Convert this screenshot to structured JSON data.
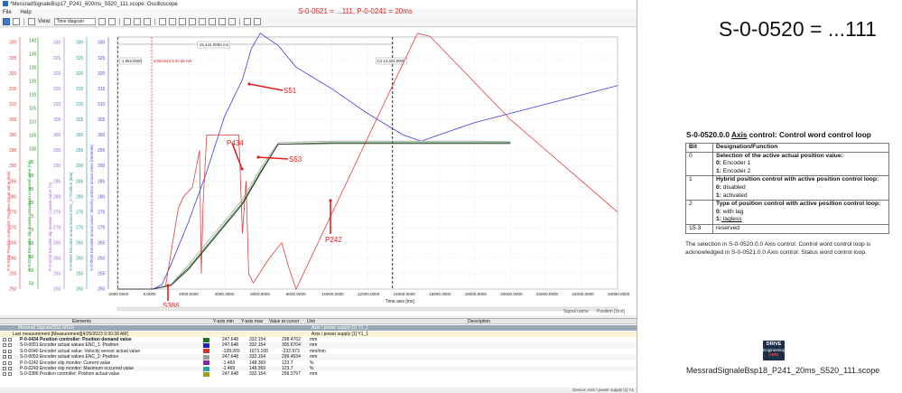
{
  "window": {
    "title": "*MessradSignaleBsp17_P241_600ms_S520_111.scope: Oscilloscope",
    "menu": [
      "File",
      "Help"
    ],
    "overlay_title": "S-0-0521 = ...111, P-0-0241 = 20ms"
  },
  "toolbar": {
    "view_label": "View:",
    "view_value": "Time diagram"
  },
  "chart_data": {
    "type": "line",
    "x_ticks": [
      "-2000.0000",
      "0.0000",
      "2000.0000",
      "4000.0000",
      "6000.0000",
      "8000.0000",
      "10000.0000",
      "12000.0000",
      "14000.0000",
      "16000.0000",
      "18000.0000",
      "20000.0000",
      "22000.0000",
      "24000.0000",
      "26000.0000"
    ],
    "xlabel": "Time axis [ms]",
    "xlim": [
      -2000,
      26000
    ],
    "y_ticks": [
      "330",
      "325",
      "320",
      "315",
      "310",
      "305",
      "300",
      "295",
      "290",
      "285",
      "280",
      "275",
      "270",
      "265",
      "260",
      "255",
      "250"
    ],
    "ylim": [
      247.648,
      332.154
    ],
    "axis_labels": [
      "S-0-0386 Position controller: Position actual value [mm]",
      "P-0-0243 Encoder slip monitor: Maximum occurred value [%]",
      "P-0-0242 Encoder slip monitor: Current value [%]",
      "S-0-0053 Encoder actual values ENC_2: Position [mm]",
      "S-0-0040 Encoder actual value: Velocity sensor actual value [mm/min]"
    ],
    "second_axis_ticks": [
      "140",
      "135",
      "130",
      "125",
      "120",
      "115",
      "110",
      "105",
      "100",
      "95",
      "90",
      "85",
      "80",
      "75",
      "70",
      "65",
      "60",
      "55",
      "50"
    ],
    "cursors": [
      {
        "label": "C1 -1.962.0000",
        "x": -1962
      },
      {
        "label": "C2 13.402.0000",
        "x": 13402
      }
    ],
    "cursor_delta": "15.444.0000 ms",
    "timestamp_label": "4/25/2023 9:30:38 AM",
    "annotations": [
      "S51",
      "P434",
      "S53",
      "P242",
      "S386"
    ],
    "series": [
      {
        "name": "P-0-0434 Position controller: Position demand value",
        "color": "#1a7a1a",
        "x": [
          -2000,
          0,
          1000,
          2000,
          3000,
          4000,
          5000,
          6000,
          7000,
          10000,
          14000,
          18000,
          20000
        ],
        "y": [
          250,
          250,
          251.5,
          257,
          264,
          271,
          278,
          288,
          297,
          297.5,
          297.5,
          297.5,
          297.5
        ]
      },
      {
        "name": "S-0-0051 Encoder actual values ENC_1: Position",
        "color": "#3c3cdc",
        "x": [
          -2000,
          0,
          500,
          1000,
          2000,
          3000,
          4000,
          5000,
          5500,
          6000,
          7000,
          8000,
          10000,
          12000,
          14000,
          15000,
          16000,
          18000,
          20000,
          22000,
          24000,
          26000
        ],
        "y": [
          250,
          250,
          251.5,
          258,
          272,
          288,
          306,
          318,
          328,
          333,
          329,
          322,
          315,
          307,
          300,
          298,
          300,
          304,
          307,
          310,
          313,
          316
        ]
      },
      {
        "name": "S-0-0040 Encoder actual value: Velocity sensor actual value",
        "color": "#e04040",
        "x": [
          -2000,
          0,
          700,
          1400,
          1700,
          2200,
          2600,
          2700,
          2800,
          3000,
          3300,
          3800,
          4800,
          5000,
          5200,
          5350,
          5600,
          6500,
          7200,
          7600,
          8000,
          13400,
          14800,
          15500,
          17000,
          20000,
          23000,
          26000
        ],
        "y": [
          250,
          250,
          251,
          276,
          280,
          283,
          295,
          255,
          278,
          300,
          300,
          300,
          300,
          268,
          285,
          255,
          252,
          260,
          265,
          257,
          250,
          316,
          333,
          332,
          323,
          305,
          290,
          275
        ]
      },
      {
        "name": "S-0-0053 Encoder actual values ENC_2: Position",
        "color": "#a0a0a0",
        "x": [
          -2000,
          0,
          1000,
          2000,
          3000,
          4000,
          5000,
          6000,
          7000,
          10000,
          14000,
          18000,
          20000
        ],
        "y": [
          250,
          250,
          251.5,
          258,
          265,
          272,
          279,
          289,
          297.5,
          298,
          298,
          298,
          297.8
        ]
      },
      {
        "name": "S-0-0386 Position controller: Position actual value",
        "color": "#222222",
        "x": [
          -2000,
          0,
          1000,
          2000,
          3000,
          4000,
          5000,
          6000,
          7000,
          10000,
          14000,
          18000,
          20000
        ],
        "y": [
          250,
          250,
          251.2,
          256.5,
          263.5,
          270.5,
          277.5,
          287.5,
          297,
          297.2,
          297.2,
          297.2,
          297.2
        ]
      }
    ]
  },
  "table": {
    "headers": [
      "Elements",
      "Y-axis min",
      "Y-axis max",
      "Value at cursor",
      "Unit",
      "Description"
    ],
    "group1": {
      "label": "Messrad Signale(S51 MSG)",
      "desc": "Axis / power supply [1] Y1_1"
    },
    "group2": {
      "label": "Last measurement [Measurement][4/25/2023 9:30:38 AM]",
      "desc": "Axis / power supply [1] Y1_1"
    },
    "rows": [
      {
        "name": "P-0-0434 Position controller: Position demand value",
        "color": "#1a7a1a",
        "min": "247.648",
        "max": "332.154",
        "cursor": "298.4762",
        "unit": "mm",
        "bold": true
      },
      {
        "name": "S-0-0051 Encoder actual values ENC_1: Position",
        "color": "#2020c0",
        "min": "247.648",
        "max": "332.154",
        "cursor": "305.6704",
        "unit": "mm",
        "bold": false
      },
      {
        "name": "S-0-0040 Encoder actual value: Velocity sensor actual value",
        "color": "#e03030",
        "min": "-128.265",
        "max": "1073.100",
        "cursor": "-232.973",
        "unit": "mm/min",
        "bold": false
      },
      {
        "name": "S-0-0053 Encoder actual values ENC_2: Position",
        "color": "#9a9a9a",
        "min": "247.648",
        "max": "332.154",
        "cursor": "299.4534",
        "unit": "mm",
        "bold": false
      },
      {
        "name": "P-0-0242 Encoder slip monitor: Current value",
        "color": "#8a1fb0",
        "min": "-1.469",
        "max": "148.369",
        "cursor": "123.7",
        "unit": "%",
        "bold": false
      },
      {
        "name": "P-0-0243 Encoder slip monitor: Maximum occurred value",
        "color": "#1fa8a8",
        "min": "-1.469",
        "max": "148.369",
        "cursor": "123.7",
        "unit": "%",
        "bold": false
      },
      {
        "name": "S-0-0386 Position controller: Position actual value",
        "color": "#a0a000",
        "min": "247.648",
        "max": "332.154",
        "cursor": "299.3797",
        "unit": "mm",
        "bold": false
      }
    ],
    "signal_name_label": "Signal name",
    "position_label": "Position [Unit]",
    "status_text": "Device: Axis / power supply [1] Y1"
  },
  "doc": {
    "big_title": "S-0-0520 = ...111",
    "heading_pre": "S-0-0520.0.0 ",
    "heading_u": "Axis",
    "heading_post": " control: Control word control loop",
    "col_bit": "Bit",
    "col_desc": "Designation/Function",
    "bit0": "0",
    "bit0_title": "Selection of the active actual position value:",
    "bit0_opt0_k": "0:",
    "bit0_opt0_v": " Encoder 1",
    "bit0_opt1_k": "1:",
    "bit0_opt1_v": " Encoder 2",
    "bit1": "1",
    "bit1_title": "Hybrid position control with active position control loop:",
    "bit1_opt0_k": "0:",
    "bit1_opt0_v": " disabled",
    "bit1_opt1_k": "1:",
    "bit1_opt1_v": " activated",
    "bit2": "2",
    "bit2_title": "Type of position control with active position control loop:",
    "bit2_opt0_k": "0:",
    "bit2_opt0_v": " with lag",
    "bit2_opt1_k": "1:",
    "bit2_opt1_v": " lagless",
    "bit15": "15-3",
    "bit15_desc": "reserved",
    "note": "The selection in S-0-0520.0.0  Axis control: Control word control loop  is acknowledged in S-0-0521.0.0 Axis control: Status word control loop.",
    "logo_l1": "DRIVE",
    "logo_l2": "Engineering",
    "logo_l3": "ctrlX",
    "filename": "MessradSignaleBsp18_P241_20ms_S520_111.scope"
  }
}
